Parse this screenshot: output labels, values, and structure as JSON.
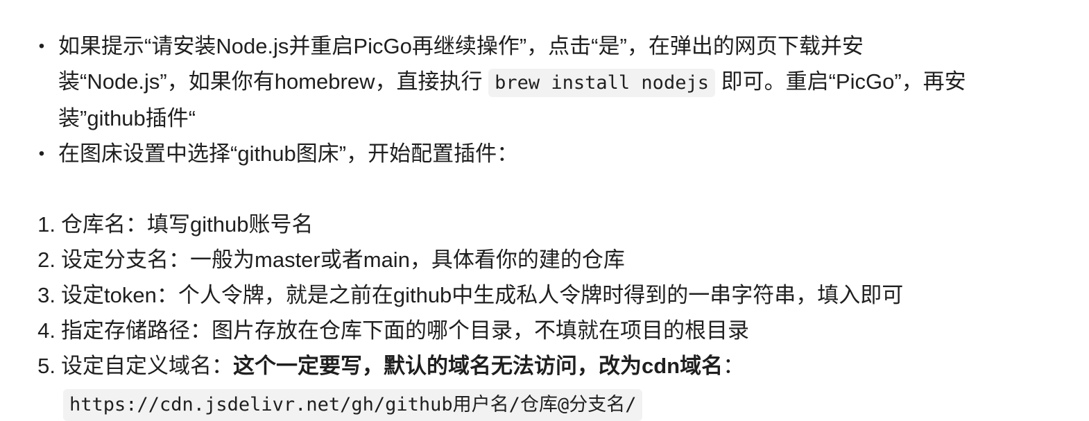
{
  "bullets": [
    {
      "marker": "•",
      "text_1": "如果提示“请安装Node.js并重启PicGo再继续操作”，点击“是”，在弹出的网页下载并安装“Node.js”，如果你有homebrew，直接执行 ",
      "code": "brew install nodejs",
      "text_2": " 即可。重启“PicGo”，再安装”github插件“"
    },
    {
      "marker": "•",
      "text_1": "在图床设置中选择“github图床”，开始配置插件："
    }
  ],
  "steps": [
    {
      "num": "1.",
      "text": "仓库名：填写github账号名"
    },
    {
      "num": "2.",
      "text": "设定分支名：一般为master或者main，具体看你的建的仓库"
    },
    {
      "num": "3.",
      "text": "设定token：个人令牌，就是之前在github中生成私人令牌时得到的一串字符串，填入即可"
    },
    {
      "num": "4.",
      "text": "指定存储路径：图片存放在仓库下面的哪个目录，不填就在项目的根目录"
    },
    {
      "num": "5.",
      "text": "设定自定义域名：",
      "bold": "这个一定要写，默认的域名无法访问，改为cdn域名",
      "tail": "："
    }
  ],
  "code_block": "https://cdn.jsdelivr.net/gh/github用户名/仓库@分支名/"
}
